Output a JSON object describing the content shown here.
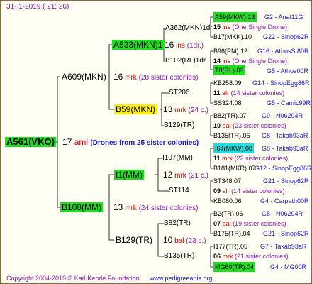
{
  "header": {
    "date": "31-  1-2019 (  21:  26)"
  },
  "footer": {
    "copyright": "Copyright 2004-2019 © Karl Kehrle Foundation",
    "site": "www.pedigreeapis.org"
  },
  "root": {
    "name": "A561(VKO)",
    "num": "17",
    "label": "aml",
    "note": "(Drones from 25 sister colonies)"
  },
  "gen1": [
    {
      "name": "A609(MKN)",
      "num": "16",
      "label": "mrk",
      "note": "(28 sister colonies)"
    },
    {
      "name": "B108(MM)",
      "num": "13",
      "label": "mrk",
      "note": "(24 sister colonies)"
    }
  ],
  "gen2": [
    {
      "name": "A533(MKN)1",
      "num": "16",
      "label": "ins",
      "note": "(1dr.)"
    },
    {
      "name": "B59(MKN)",
      "num": "13",
      "label": "mrk",
      "note": "(24 c.)"
    },
    {
      "name": "I1(MM)",
      "num": "12",
      "label": "mrk",
      "note": "(21 c.)"
    },
    {
      "name": "B129(TR)",
      "num": "10",
      "label": "bal",
      "note": "(23 c.)"
    }
  ],
  "gen3": [
    {
      "name": "A362(MKN)1dr"
    },
    {
      "name": "B102(RL)1dr"
    },
    {
      "name": "ST206",
      "num": "11",
      "label": "alr",
      "note": "(14 sister colonies)"
    },
    {
      "name": "B129(TR)",
      "num": "10",
      "label": "bal",
      "note": "(23 sister colonies)"
    },
    {
      "name": "I107(MM)",
      "num": "11",
      "label": "mrk",
      "note": "(22 sister colonies)"
    },
    {
      "name": "ST114",
      "num": "09",
      "label": "alr",
      "note": "(14 sister colonies)"
    },
    {
      "name": "B82(TR)",
      "num": "07",
      "label": "bal",
      "note": "(19 sister colonies)"
    },
    {
      "name": "B135(TR)",
      "num": "06",
      "label": "mrk",
      "note": "(21 sister colonies)"
    }
  ],
  "gen3_extra": [
    {
      "num": "15",
      "label": "ins",
      "note": "(One Single Drone)"
    },
    {
      "num": "14",
      "label": "ins",
      "note": "(One Single Drone)"
    }
  ],
  "gen4": [
    {
      "name": "A59(MKW).13",
      "code": "G2 - Anat11G"
    },
    {
      "name": "B17(MKK).10",
      "code": "G22 - Sinop62R"
    },
    {
      "name": "B96(PM).12",
      "code": "G16 - AthosSt80R"
    },
    {
      "name": "T8(RL).09",
      "code": "G5 - Athos00R"
    },
    {
      "name": "KB258.09",
      "code": "G14 - SinopEgg86R"
    },
    {
      "name": "SS324.08",
      "code": "G5 - Camic99R"
    },
    {
      "name": "B82(TR).07",
      "code": "G9 - N06294R"
    },
    {
      "name": "B135(TR).06",
      "code": "G8 - Takab93aR"
    },
    {
      "name": "I64(MKW).08",
      "code": "G8 - Takab93aR"
    },
    {
      "name": "B181(MKR).07",
      "code": "G12 - SinopEgg86R"
    },
    {
      "name": "ST348.07",
      "code": "G21 - Sinop62R"
    },
    {
      "name": "KB080.06",
      "code": "G4 - Carpath00R"
    },
    {
      "name": "B2(TR).06",
      "code": "G8 - N06294R"
    },
    {
      "name": "B175(TR).04",
      "code": "G21 - Sinop62R"
    },
    {
      "name": "I177(TR).05",
      "code": "G7 - Takab93aR"
    },
    {
      "name": "MG60(TR).04",
      "code": "G4 - MG00R"
    }
  ]
}
